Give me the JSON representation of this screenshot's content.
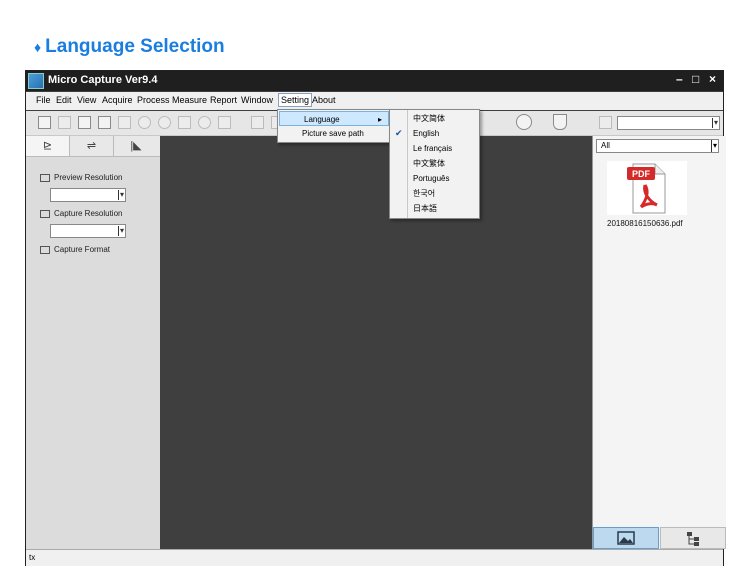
{
  "heading": {
    "bullet": "♦",
    "text": "Language Selection"
  },
  "window": {
    "title": "Micro Capture Ver9.4",
    "minimize": "–",
    "maximize": "□",
    "close": "×"
  },
  "menu": [
    "File",
    "Edit",
    "View",
    "Acquire",
    "Process",
    "Measure",
    "Report",
    "Window",
    "Setting",
    "About"
  ],
  "setting_menu": {
    "items": [
      "Language",
      "Picture save path"
    ],
    "submenu_arrow": "▸"
  },
  "language_menu": {
    "selected": "English",
    "check": "✔",
    "items": [
      "中文简体",
      "English",
      "Le français",
      "中文繁体",
      "Português",
      "한국어",
      "日本語"
    ]
  },
  "left_panel": {
    "tabs": [
      "⊵",
      "⇌",
      "|◣"
    ],
    "preview_resolution": "Preview Resolution",
    "capture_resolution": "Capture Resolution",
    "capture_format": "Capture Format",
    "dropdown_arrow": "▾"
  },
  "right_panel": {
    "filter_value": "All",
    "file_name": "20180816150636.pdf",
    "pdf_label": "PDF"
  },
  "status": {
    "text": "tx"
  }
}
